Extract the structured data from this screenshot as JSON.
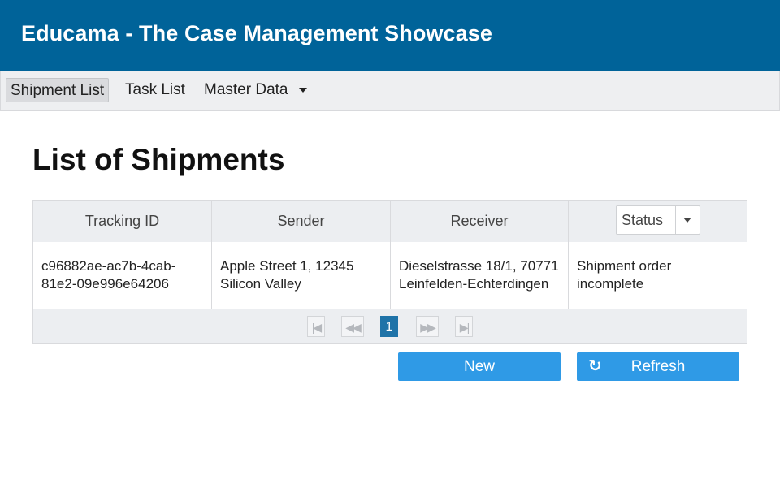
{
  "app": {
    "title": "Educama - The Case Management Showcase"
  },
  "menu": {
    "items": [
      {
        "label": "Shipment List",
        "active": true
      },
      {
        "label": "Task List",
        "active": false
      },
      {
        "label": "Master Data",
        "active": false,
        "dropdown": true
      }
    ]
  },
  "page": {
    "title": "List of Shipments"
  },
  "table": {
    "columns": [
      "Tracking ID",
      "Sender",
      "Receiver"
    ],
    "status_filter": {
      "label": "Status"
    },
    "rows": [
      {
        "tracking_id": "c96882ae-ac7b-4cab-81e2-09e996e64206",
        "sender": "Apple Street 1, 12345 Silicon Valley",
        "receiver": "Dieselstrasse 18/1, 70771 Leinfelden-Echterdingen",
        "status": "Shipment order incomplete"
      }
    ],
    "pager": {
      "first_icon": "first-page-icon",
      "prev_icon": "previous-page-icon",
      "current_page": "1",
      "next_icon": "next-page-icon",
      "last_icon": "last-page-icon"
    }
  },
  "actions": {
    "new_label": "New",
    "refresh_label": "Refresh",
    "refresh_icon": "refresh-icon"
  },
  "colors": {
    "header_bg": "#006399",
    "button_bg": "#2f9ae6",
    "active_page": "#1f73a8"
  }
}
